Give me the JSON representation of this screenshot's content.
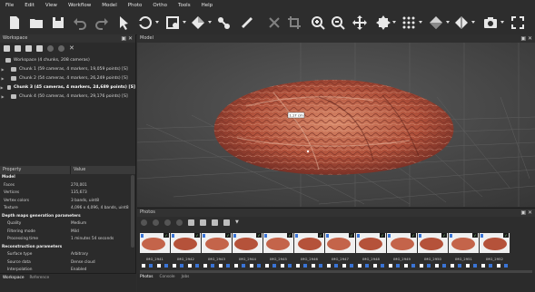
{
  "menu": [
    "File",
    "Edit",
    "View",
    "Workflow",
    "Model",
    "Photo",
    "Ortho",
    "Tools",
    "Help"
  ],
  "toolbar": {
    "icons": [
      "new-icon",
      "open-icon",
      "save-icon",
      "undo-icon",
      "redo-icon",
      "navigation-icon",
      "rotate-icon",
      "select-icon",
      "shape-icon",
      "ruler-icon",
      "delete-icon",
      "crop-icon",
      "zoom-in-icon",
      "zoom-out-icon",
      "move-icon",
      "pan-icon",
      "reset-view-icon",
      "grid-icon",
      "model-view-icon",
      "camera-icon",
      "fullscreen-icon"
    ]
  },
  "workspace": {
    "title": "Workspace",
    "root": "Workspace (4 chunks, 208 cameras)",
    "chunks": [
      {
        "label": "Chunk 1 (59 cameras, 4 markers, 19,059 points) [S]",
        "active": false
      },
      {
        "label": "Chunk 2 (54 cameras, 4 markers, 26,249 points) [S]",
        "active": false
      },
      {
        "label": "Chunk 3 (45 cameras, 4 markers, 24,689 points) [S]",
        "active": true
      },
      {
        "label": "Chunk 4 (50 cameras, 4 markers, 29,176 points) [S]",
        "active": false
      }
    ]
  },
  "properties": {
    "col_property": "Property",
    "col_value": "Value",
    "rows": [
      {
        "type": "section",
        "key": "Model",
        "value": ""
      },
      {
        "type": "row",
        "key": "Faces",
        "value": "270,001"
      },
      {
        "type": "row",
        "key": "Vertices",
        "value": "135,673"
      },
      {
        "type": "row",
        "key": "Vertex colors",
        "value": "3 bands, uint8"
      },
      {
        "type": "row",
        "key": "Texture",
        "value": "4,096 x 4,096, 4 bands, uint8"
      },
      {
        "type": "section",
        "key": "Depth maps generation parameters",
        "value": ""
      },
      {
        "type": "sub",
        "key": "Quality",
        "value": "Medium"
      },
      {
        "type": "sub",
        "key": "Filtering mode",
        "value": "Mild"
      },
      {
        "type": "sub",
        "key": "Processing time",
        "value": "1 minutes 54 seconds"
      },
      {
        "type": "section",
        "key": "Reconstruction parameters",
        "value": ""
      },
      {
        "type": "sub",
        "key": "Surface type",
        "value": "Arbitrary"
      },
      {
        "type": "sub",
        "key": "Source data",
        "value": "Dense cloud"
      },
      {
        "type": "sub",
        "key": "Interpolation",
        "value": "Enabled"
      }
    ]
  },
  "left_tabs": [
    "Workspace",
    "Reference"
  ],
  "model": {
    "title": "Model",
    "measurement": "1.17 cm"
  },
  "photos": {
    "title": "Photos",
    "items": [
      "IMG_2941",
      "IMG_2942",
      "IMG_2943",
      "IMG_2944",
      "IMG_2945",
      "IMG_2946",
      "IMG_2947",
      "IMG_2948",
      "IMG_2949",
      "IMG_2950",
      "IMG_2951",
      "IMG_2952"
    ]
  },
  "right_tabs": [
    "Photos",
    "Console",
    "Jobs"
  ]
}
